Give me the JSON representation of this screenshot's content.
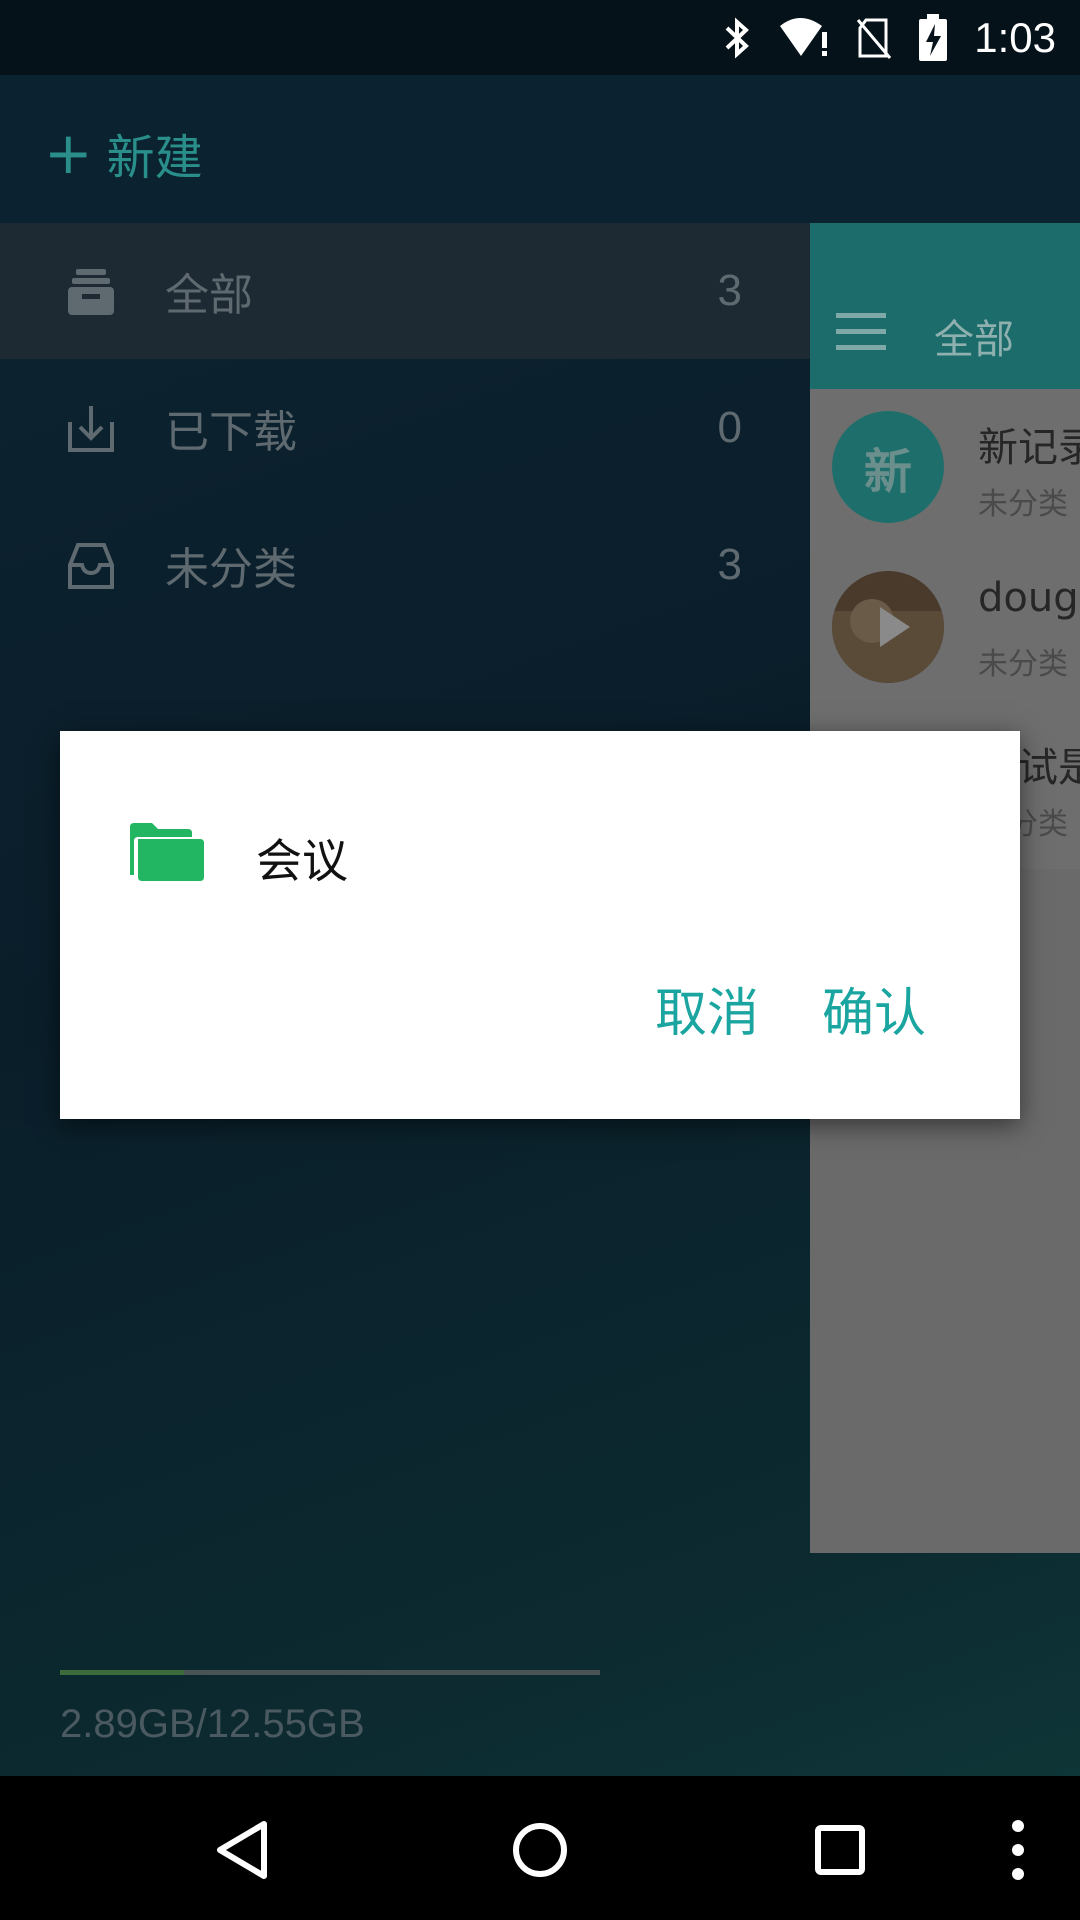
{
  "status_bar": {
    "time": "1:03",
    "icons": [
      "bluetooth-icon",
      "wifi-alert-icon",
      "no-sim-icon",
      "battery-charging-icon"
    ]
  },
  "drawer": {
    "new_button": {
      "plus": "+",
      "label": "新建"
    },
    "items": [
      {
        "icon": "archive-icon",
        "label": "全部",
        "count": "3",
        "active": true
      },
      {
        "icon": "download-icon",
        "label": "已下载",
        "count": "0",
        "active": false
      },
      {
        "icon": "inbox-icon",
        "label": "未分类",
        "count": "3",
        "active": false
      }
    ],
    "storage": {
      "text": "2.89GB/12.55GB",
      "used_fraction": 0.23
    }
  },
  "main_panel": {
    "title": "全部",
    "items": [
      {
        "avatar_text": "新",
        "title": "新记录",
        "subtitle": "未分类"
      },
      {
        "title": "dough",
        "subtitle": "未分类"
      },
      {
        "title": "测试是",
        "subtitle": "未分类"
      }
    ]
  },
  "dialog": {
    "folder_name": "会议",
    "cancel_label": "取消",
    "confirm_label": "确认"
  },
  "colors": {
    "accent": "#1aa5a0",
    "folder": "#22b562",
    "toolbar": "#1b6c6a"
  }
}
